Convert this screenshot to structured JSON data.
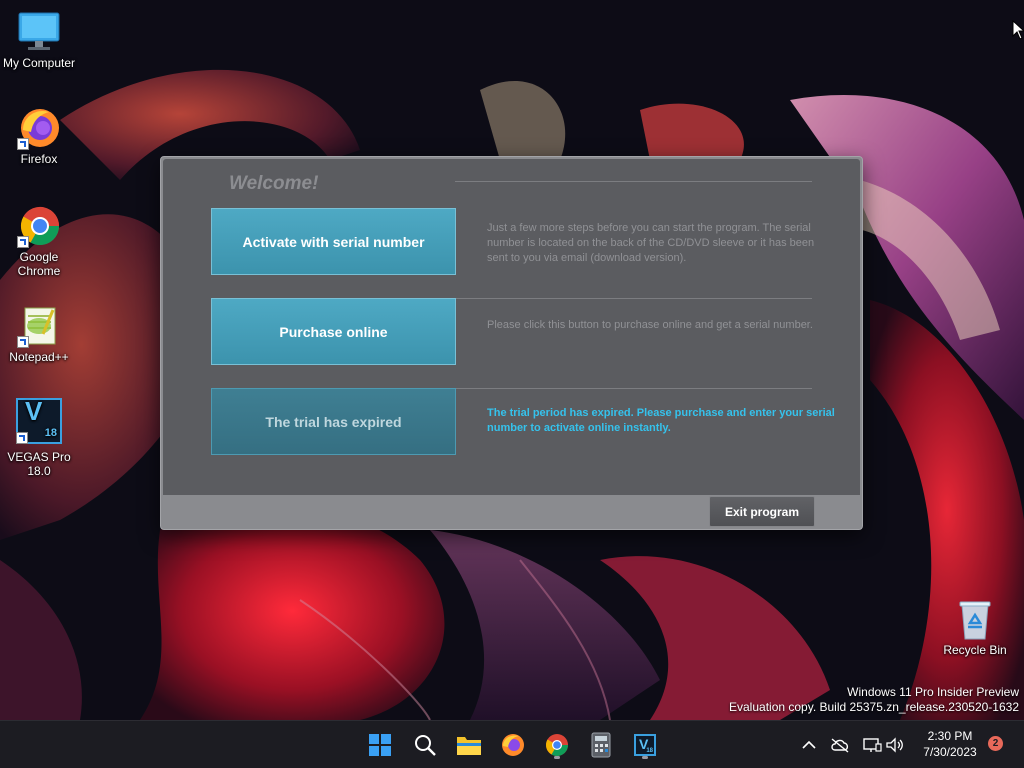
{
  "desktop": {
    "icons": [
      {
        "id": "my-computer",
        "label": "My Computer",
        "icon": "monitor-icon"
      },
      {
        "id": "firefox",
        "label": "Firefox",
        "icon": "firefox-icon"
      },
      {
        "id": "chrome",
        "label": "Google Chrome",
        "icon": "chrome-icon"
      },
      {
        "id": "notepadpp",
        "label": "Notepad++",
        "icon": "notepad-plus-plus-icon"
      },
      {
        "id": "vegas",
        "label": "VEGAS Pro 18.0",
        "icon": "vegas-pro-icon",
        "badge": "18",
        "letter": "V"
      }
    ],
    "recycle_bin": {
      "label": "Recycle Bin",
      "icon": "recycle-bin-icon"
    }
  },
  "dialog": {
    "title": "Welcome!",
    "rows": [
      {
        "button": "Activate with serial number",
        "description": "Just a few more steps before you can start the program. The serial number is located on the back of the CD/DVD sleeve or it has been sent to you via email (download version).",
        "state": "enabled"
      },
      {
        "button": "Purchase online",
        "description": "Please click this button to purchase online and get a serial number.",
        "state": "enabled"
      },
      {
        "button": "The trial has expired",
        "description": "The trial period has expired. Please purchase and enter your serial number to activate online instantly.",
        "state": "disabled"
      }
    ],
    "exit_label": "Exit program"
  },
  "watermark": {
    "line1": "Windows 11 Pro Insider Preview",
    "line2": "Evaluation copy. Build 25375.zn_release.230520-1632"
  },
  "taskbar": {
    "apps": [
      "start-icon",
      "search-icon",
      "file-explorer-icon",
      "firefox-icon",
      "chrome-icon",
      "calculator-icon",
      "vegas-pro-icon"
    ],
    "vegas_letter": "V",
    "vegas_badge": "18",
    "tray": [
      "chevron-up-icon",
      "cloud-offline-icon",
      "display-icon",
      "speaker-icon"
    ],
    "time": "2:30 PM",
    "date": "7/30/2023",
    "notifications": "2"
  },
  "colors": {
    "button_accent": "#4ea9c4",
    "alert_text": "#35c2ec",
    "dialog_bg": "#5b5c60"
  }
}
